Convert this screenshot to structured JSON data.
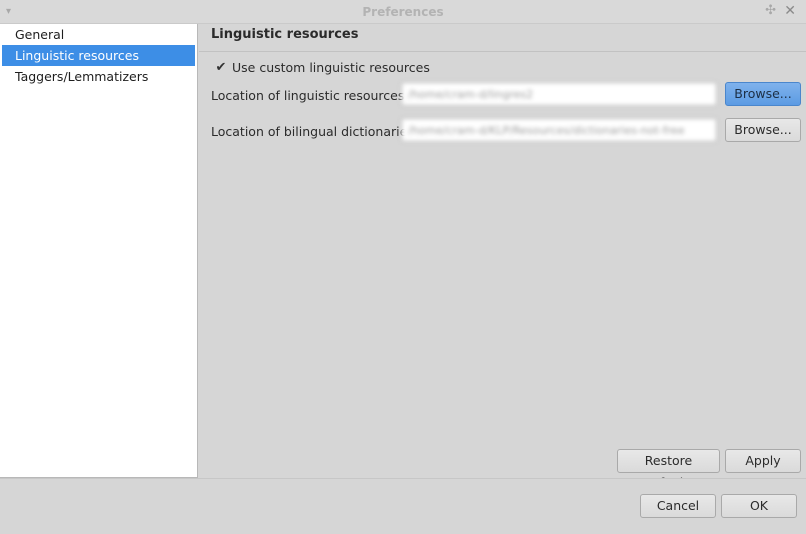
{
  "window": {
    "title": "Preferences",
    "menu_glyph": "▾",
    "pin_glyph": "✣",
    "close_glyph": "✕"
  },
  "sidebar": {
    "items": [
      {
        "label": "General",
        "selected": false
      },
      {
        "label": "Linguistic resources",
        "selected": true
      },
      {
        "label": "Taggers/Lemmatizers",
        "selected": false
      }
    ]
  },
  "page": {
    "title": "Linguistic resources",
    "checkbox": {
      "label": "Use custom linguistic resources",
      "checked": true,
      "glyph": "✔"
    },
    "fields": [
      {
        "label": "Location of linguistic resources:",
        "value": "/home/cram-d/lingres2",
        "button": "Browse..."
      },
      {
        "label": "Location of bilingual dictionaries:",
        "value": "/home/cram-d/KLP/Resources/dictionaries-not-free",
        "button": "Browse..."
      }
    ],
    "restore_defaults": "Restore Defaults",
    "apply": "Apply"
  },
  "footer": {
    "cancel": "Cancel",
    "ok": "OK"
  },
  "colors": {
    "selection": "#3d8ee6",
    "focused_button": "#5c9be3",
    "background": "#d6d6d6"
  }
}
